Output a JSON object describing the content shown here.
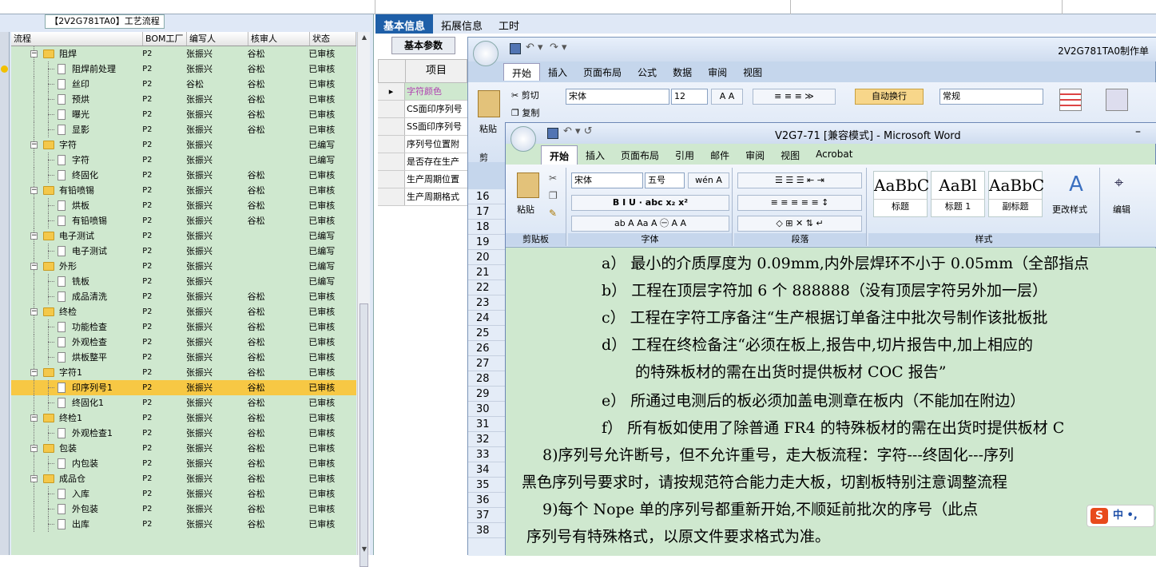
{
  "left_panel": {
    "title": "【2V2G781TA0】工艺流程",
    "columns": [
      "流程",
      "BOM工厂",
      "编写人",
      "核审人",
      "状态"
    ],
    "rows": [
      {
        "level": 0,
        "name": "阻焊",
        "bom": "P2",
        "writer": "张振兴",
        "reviewer": "谷松",
        "status": "已审核"
      },
      {
        "level": 1,
        "name": "阻焊前处理",
        "bom": "P2",
        "writer": "张振兴",
        "reviewer": "谷松",
        "status": "已审核"
      },
      {
        "level": 1,
        "name": "丝印",
        "bom": "P2",
        "writer": "谷松",
        "reviewer": "谷松",
        "status": "已审核"
      },
      {
        "level": 1,
        "name": "预烘",
        "bom": "P2",
        "writer": "张振兴",
        "reviewer": "谷松",
        "status": "已审核"
      },
      {
        "level": 1,
        "name": "曝光",
        "bom": "P2",
        "writer": "张振兴",
        "reviewer": "谷松",
        "status": "已审核"
      },
      {
        "level": 1,
        "name": "显影",
        "bom": "P2",
        "writer": "张振兴",
        "reviewer": "谷松",
        "status": "已审核"
      },
      {
        "level": 0,
        "name": "字符",
        "bom": "P2",
        "writer": "张振兴",
        "reviewer": "",
        "status": "已编写"
      },
      {
        "level": 1,
        "name": "字符",
        "bom": "P2",
        "writer": "张振兴",
        "reviewer": "",
        "status": "已编写"
      },
      {
        "level": 1,
        "name": "终固化",
        "bom": "P2",
        "writer": "张振兴",
        "reviewer": "谷松",
        "status": "已审核"
      },
      {
        "level": 0,
        "name": "有铅喷锡",
        "bom": "P2",
        "writer": "张振兴",
        "reviewer": "谷松",
        "status": "已审核"
      },
      {
        "level": 1,
        "name": "烘板",
        "bom": "P2",
        "writer": "张振兴",
        "reviewer": "谷松",
        "status": "已审核"
      },
      {
        "level": 1,
        "name": "有铅喷锡",
        "bom": "P2",
        "writer": "张振兴",
        "reviewer": "谷松",
        "status": "已审核"
      },
      {
        "level": 0,
        "name": "电子测试",
        "bom": "P2",
        "writer": "张振兴",
        "reviewer": "",
        "status": "已编写"
      },
      {
        "level": 1,
        "name": "电子测试",
        "bom": "P2",
        "writer": "张振兴",
        "reviewer": "",
        "status": "已编写"
      },
      {
        "level": 0,
        "name": "外形",
        "bom": "P2",
        "writer": "张振兴",
        "reviewer": "",
        "status": "已编写"
      },
      {
        "level": 1,
        "name": "铣板",
        "bom": "P2",
        "writer": "张振兴",
        "reviewer": "",
        "status": "已编写"
      },
      {
        "level": 1,
        "name": "成品清洗",
        "bom": "P2",
        "writer": "张振兴",
        "reviewer": "谷松",
        "status": "已审核"
      },
      {
        "level": 0,
        "name": "终检",
        "bom": "P2",
        "writer": "张振兴",
        "reviewer": "谷松",
        "status": "已审核"
      },
      {
        "level": 1,
        "name": "功能检查",
        "bom": "P2",
        "writer": "张振兴",
        "reviewer": "谷松",
        "status": "已审核"
      },
      {
        "level": 1,
        "name": "外观检查",
        "bom": "P2",
        "writer": "张振兴",
        "reviewer": "谷松",
        "status": "已审核"
      },
      {
        "level": 1,
        "name": "烘板整平",
        "bom": "P2",
        "writer": "张振兴",
        "reviewer": "谷松",
        "status": "已审核"
      },
      {
        "level": 0,
        "name": "字符1",
        "bom": "P2",
        "writer": "张振兴",
        "reviewer": "谷松",
        "status": "已审核"
      },
      {
        "level": 1,
        "name": "印序列号1",
        "bom": "P2",
        "writer": "张振兴",
        "reviewer": "谷松",
        "status": "已审核",
        "selected": true
      },
      {
        "level": 1,
        "name": "终固化1",
        "bom": "P2",
        "writer": "张振兴",
        "reviewer": "谷松",
        "status": "已审核"
      },
      {
        "level": 0,
        "name": "终检1",
        "bom": "P2",
        "writer": "张振兴",
        "reviewer": "谷松",
        "status": "已审核"
      },
      {
        "level": 1,
        "name": "外观检查1",
        "bom": "P2",
        "writer": "张振兴",
        "reviewer": "谷松",
        "status": "已审核"
      },
      {
        "level": 0,
        "name": "包装",
        "bom": "P2",
        "writer": "张振兴",
        "reviewer": "谷松",
        "status": "已审核"
      },
      {
        "level": 1,
        "name": "内包装",
        "bom": "P2",
        "writer": "张振兴",
        "reviewer": "谷松",
        "status": "已审核"
      },
      {
        "level": 0,
        "name": "成品仓",
        "bom": "P2",
        "writer": "张振兴",
        "reviewer": "谷松",
        "status": "已审核"
      },
      {
        "level": 1,
        "name": "入库",
        "bom": "P2",
        "writer": "张振兴",
        "reviewer": "谷松",
        "status": "已审核"
      },
      {
        "level": 1,
        "name": "外包装",
        "bom": "P2",
        "writer": "张振兴",
        "reviewer": "谷松",
        "status": "已审核"
      },
      {
        "level": 1,
        "name": "出库",
        "bom": "P2",
        "writer": "张振兴",
        "reviewer": "谷松",
        "status": "已审核"
      }
    ]
  },
  "right_tabs": [
    "基本信息",
    "拓展信息",
    "工时"
  ],
  "sub_tab": "基本参数",
  "param_table": {
    "header": "项目",
    "rows": [
      "字符颜色",
      "CS面印序列号",
      "SS面印序列号",
      "序列号位置附",
      "是否存在生产",
      "生产周期位置",
      "生产周期格式"
    ]
  },
  "excel": {
    "title": "2V2G781TA0制作单",
    "tabs": [
      "开始",
      "插入",
      "页面布局",
      "公式",
      "数据",
      "审阅",
      "视图"
    ],
    "cut": "剪切",
    "copy": "复制",
    "paste": "粘贴",
    "clipboard": "剪",
    "font": "宋体",
    "size": "12",
    "wrap": "自动换行",
    "format": "常规",
    "row_numbers": [
      "16",
      "17",
      "18",
      "19",
      "20",
      "21",
      "22",
      "23",
      "24",
      "25",
      "26",
      "27",
      "28",
      "29",
      "30",
      "31",
      "32",
      "33",
      "34",
      "35",
      "36",
      "37",
      "38"
    ]
  },
  "word": {
    "title": "V2G7-71 [兼容模式] - Microsoft Word",
    "tabs": [
      "开始",
      "插入",
      "页面布局",
      "引用",
      "邮件",
      "审阅",
      "视图",
      "Acrobat"
    ],
    "paste": "粘贴",
    "clipboard_group": "剪贴板",
    "font_name": "宋体",
    "font_size": "五号",
    "font_group": "字体",
    "paragraph_group": "段落",
    "styles_group": "样式",
    "styles": [
      {
        "sample": "AaBbC",
        "name": "标题"
      },
      {
        "sample": "AaBl",
        "name": "标题 1"
      },
      {
        "sample": "AaBbC",
        "name": "副标题"
      }
    ],
    "change_styles": "更改样式",
    "edit": "编辑",
    "doc_lines": [
      "a） 最小的介质厚度为 0.09mm,内外层焊环不小于 0.05mm（全部指点",
      "b） 工程在顶层字符加 6 个 888888（没有顶层字符另外加一层）",
      "c） 工程在字符工序备注“生产根据订单备注中批次号制作该批板批",
      "d） 工程在终检备注“必须在板上,报告中,切片报告中,加上相应的",
      "的特殊板材的需在出货时提供板材 COC 报告”",
      "e） 所通过电测后的板必须加盖电测章在板内（不能加在附边）",
      "f） 所有板如使用了除普通 FR4 的特殊板材的需在出货时提供板材 C",
      "8)序列号允许断号，但不允许重号，走大板流程：字符---终固化---序列",
      "黑色序列号要求时，请按规范符合能力走大板，切割板特别注意调整流程",
      "9)每个 Nope 单的序列号都重新开始,不顺延前批次的序号（此点",
      "序列号有特殊格式，以原文件要求格式为准。"
    ],
    "ime_text": "中 •,"
  }
}
